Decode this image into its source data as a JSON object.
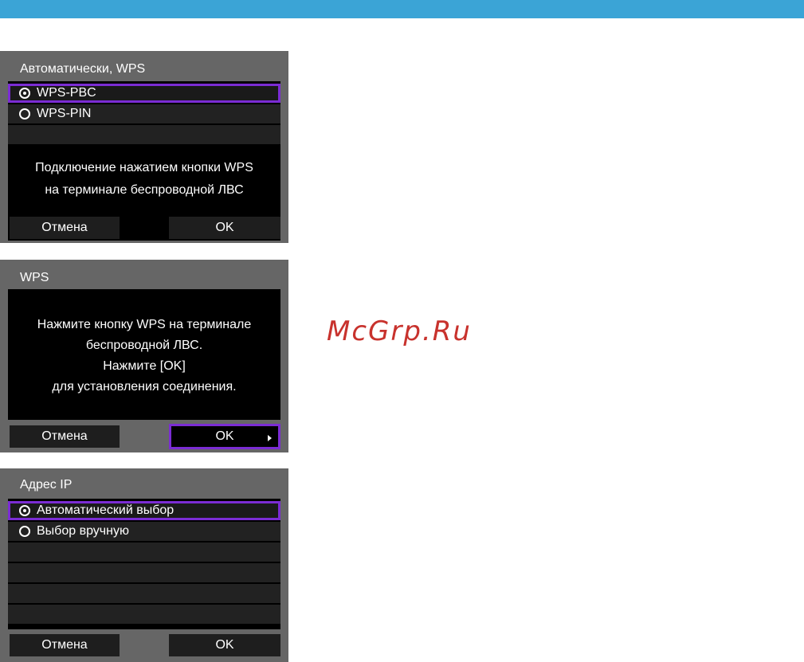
{
  "colors": {
    "top_bar": "#3ba4d6",
    "selection_border": "#7b2cd4",
    "watermark": "#c8322d"
  },
  "screen1": {
    "title": "Автоматически, WPS",
    "options": [
      {
        "label": "WPS-PBC",
        "selected": true
      },
      {
        "label": "WPS-PIN",
        "selected": false
      }
    ],
    "description_line1": "Подключение нажатием кнопки WPS",
    "description_line2": "на терминале беспроводной ЛВС",
    "cancel_label": "Отмена",
    "ok_label": "OK"
  },
  "screen2": {
    "title": "WPS",
    "message_line1": "Нажмите кнопку WPS на терминале",
    "message_line2": "беспроводной ЛВС.",
    "message_line3": "Нажмите [OK]",
    "message_line4": "для установления соединения.",
    "cancel_label": "Отмена",
    "ok_label": "OK"
  },
  "screen3": {
    "title": "Адрес IP",
    "options": [
      {
        "label": "Автоматический выбор",
        "selected": true
      },
      {
        "label": "Выбор вручную",
        "selected": false
      }
    ],
    "cancel_label": "Отмена",
    "ok_label": "OK"
  },
  "watermark": "McGrp.Ru"
}
